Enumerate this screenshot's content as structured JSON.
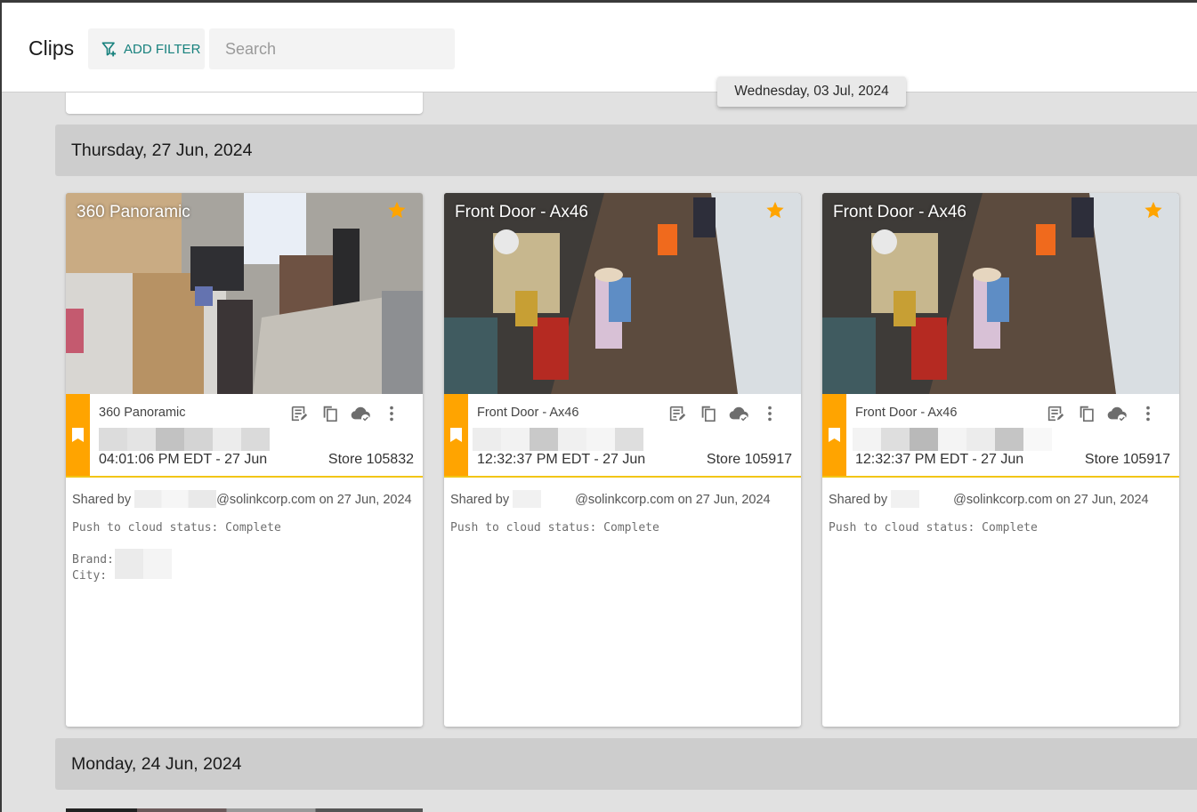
{
  "header": {
    "title": "Clips",
    "add_filter_label": "ADD FILTER",
    "search_placeholder": "Search",
    "search_value": ""
  },
  "floating_date": "Wednesday, 03 Jul, 2024",
  "accent_colors": {
    "bookmark_strip": "#ffa400",
    "info_underline": "#f2c516",
    "filter_teal": "#17817d",
    "star": "#ffa400"
  },
  "groups": [
    {
      "date": "Thursday, 27 Jun, 2024",
      "clips": [
        {
          "thumb_label": "360 Panoramic",
          "starred": true,
          "camera": "360 Panoramic",
          "time": "04:01:06 PM EDT - 27 Jun",
          "store": "Store 105832",
          "shared_prefix": "Shared by",
          "shared_suffix": "@solinkcorp.com on 27 Jun, 2024",
          "push_status": "Push to cloud status: Complete",
          "brand_label": "Brand:",
          "city_label": "City:",
          "actions": [
            "notes-icon",
            "copy-icon",
            "cloud-done-icon",
            "more-vert-icon"
          ]
        },
        {
          "thumb_label": "Front Door - Ax46",
          "starred": true,
          "camera": "Front Door - Ax46",
          "time": "12:32:37 PM EDT - 27 Jun",
          "store": "Store 105917",
          "shared_prefix": "Shared by",
          "shared_suffix": "@solinkcorp.com on 27 Jun, 2024",
          "push_status": "Push to cloud status: Complete",
          "actions": [
            "notes-icon",
            "copy-icon",
            "cloud-done-icon",
            "more-vert-icon"
          ]
        },
        {
          "thumb_label": "Front Door - Ax46",
          "starred": true,
          "camera": "Front Door - Ax46",
          "time": "12:32:37 PM EDT - 27 Jun",
          "store": "Store 105917",
          "shared_prefix": "Shared by",
          "shared_suffix": "@solinkcorp.com on 27 Jun, 2024",
          "push_status": "Push to cloud status: Complete",
          "actions": [
            "notes-icon",
            "copy-icon",
            "cloud-done-icon",
            "more-vert-icon"
          ]
        }
      ]
    },
    {
      "date": "Monday, 24 Jun, 2024",
      "clips": []
    }
  ]
}
